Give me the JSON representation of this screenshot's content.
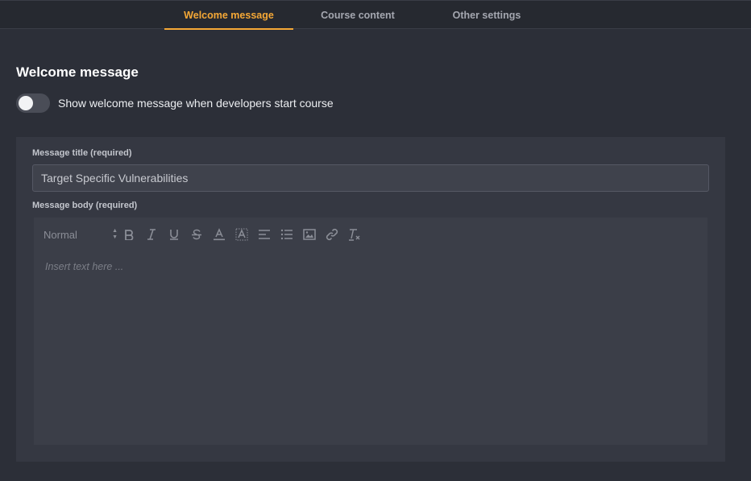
{
  "tabs": [
    {
      "label": "Welcome message",
      "active": true
    },
    {
      "label": "Course content",
      "active": false
    },
    {
      "label": "Other settings",
      "active": false
    }
  ],
  "section": {
    "title": "Welcome message",
    "toggle_label": "Show welcome message when developers start course",
    "toggle_on": false
  },
  "form": {
    "title_label": "Message title (required)",
    "title_value": "Target Specific Vulnerabilities",
    "body_label": "Message body (required)",
    "body_placeholder": "Insert text here ..."
  },
  "toolbar": {
    "format_value": "Normal",
    "buttons": [
      "bold-icon",
      "italic-icon",
      "underline-icon",
      "strikethrough-icon",
      "text-color-icon",
      "background-color-icon",
      "align-icon",
      "bullet-list-icon",
      "image-icon",
      "link-icon",
      "clear-format-icon"
    ]
  },
  "colors": {
    "accent": "#f5a836",
    "background": "#2c2f38",
    "panel": "#353842"
  }
}
